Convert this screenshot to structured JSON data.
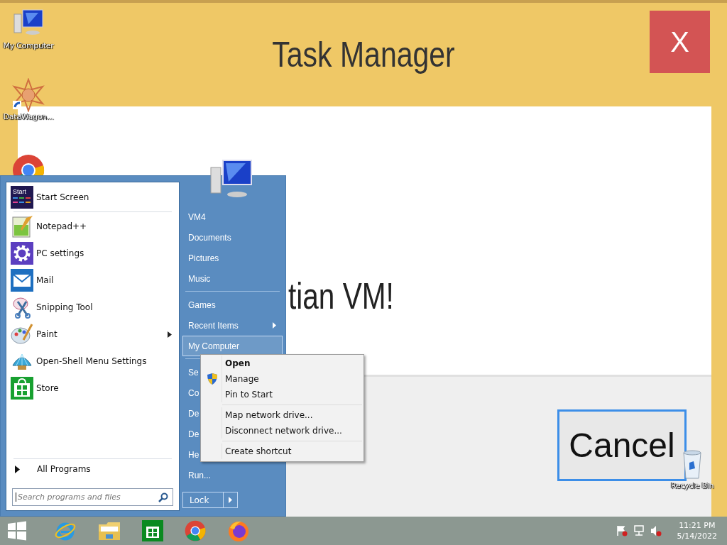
{
  "window": {
    "title": "Task Manager",
    "close": "X",
    "message": "tian VM!",
    "buttons": [
      "Cancel"
    ]
  },
  "desktop_icons": [
    {
      "label": "My Computer"
    },
    {
      "label": "DataWagon..."
    },
    {
      "label": "Recycle Bin"
    }
  ],
  "start_menu": {
    "pinned": [
      {
        "label": "Start Screen",
        "badge": "Start",
        "has_submenu": false
      },
      {
        "label": "Notepad++",
        "has_submenu": false
      },
      {
        "label": "PC settings",
        "has_submenu": false
      },
      {
        "label": "Mail",
        "has_submenu": false
      },
      {
        "label": "Snipping Tool",
        "has_submenu": false
      },
      {
        "label": "Paint",
        "has_submenu": true
      },
      {
        "label": "Open-Shell Menu Settings",
        "has_submenu": false
      },
      {
        "label": "Store",
        "has_submenu": false
      }
    ],
    "all_programs": "All Programs",
    "search": {
      "placeholder": "Search programs and files"
    },
    "place_groups": [
      [
        {
          "label": "VM4",
          "selected": false,
          "has_submenu": false
        },
        {
          "label": "Documents",
          "selected": false,
          "has_submenu": false
        },
        {
          "label": "Pictures",
          "selected": false,
          "has_submenu": false
        },
        {
          "label": "Music",
          "selected": false,
          "has_submenu": false
        }
      ],
      [
        {
          "label": "Games",
          "selected": false,
          "has_submenu": false
        },
        {
          "label": "Recent Items",
          "selected": false,
          "has_submenu": true
        },
        {
          "label": "My Computer",
          "selected": true,
          "has_submenu": false
        }
      ],
      [
        {
          "label": "Se",
          "selected": false
        },
        {
          "label": "Co",
          "selected": false
        },
        {
          "label": "De",
          "selected": false
        },
        {
          "label": "De",
          "selected": false
        },
        {
          "label": "He",
          "selected": false
        },
        {
          "label": "Run...",
          "selected": false,
          "has_submenu": false
        }
      ]
    ],
    "lock": "Lock"
  },
  "context_menu": {
    "groups": [
      [
        {
          "label": "Open",
          "bold": true,
          "shield": false
        },
        {
          "label": "Manage",
          "bold": false,
          "shield": true
        },
        {
          "label": "Pin to Start",
          "bold": false,
          "shield": false
        }
      ],
      [
        {
          "label": "Map network drive...",
          "bold": false,
          "shield": false
        },
        {
          "label": "Disconnect network drive...",
          "bold": false,
          "shield": false
        }
      ],
      [
        {
          "label": "Create shortcut",
          "bold": false,
          "shield": false
        }
      ]
    ]
  },
  "taskbar": {
    "time": "11:21 PM",
    "date": "5/14/2022"
  }
}
